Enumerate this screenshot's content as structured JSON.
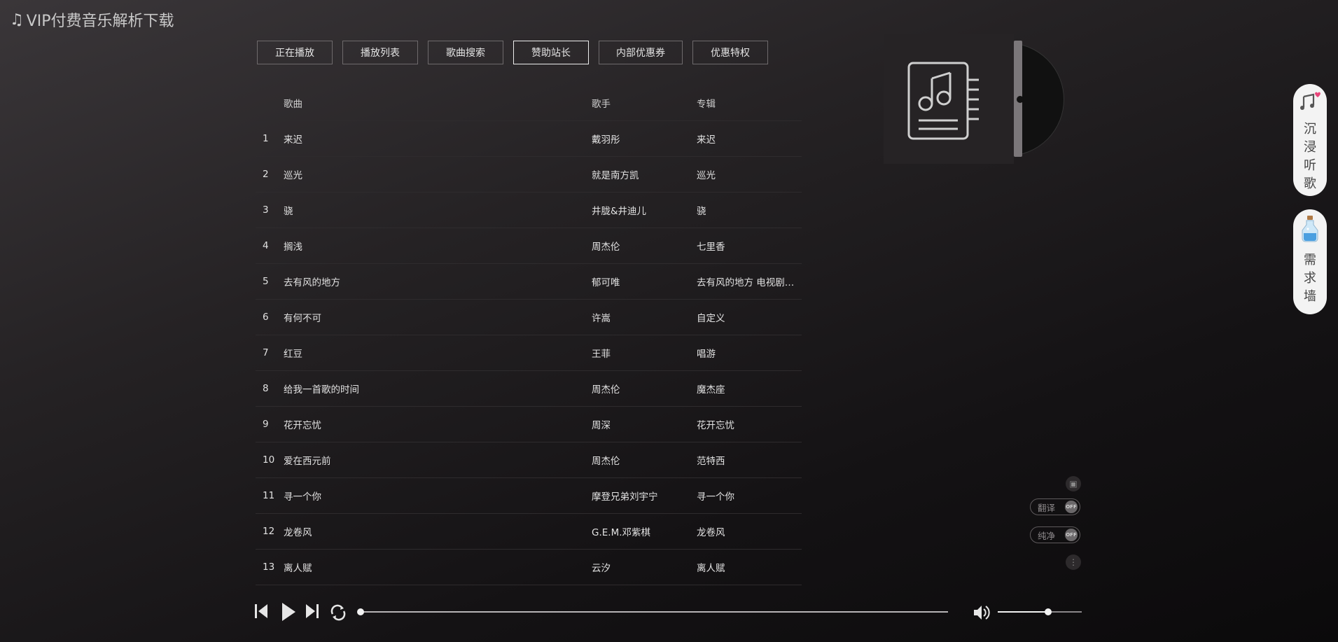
{
  "app": {
    "title": "VIP付费音乐解析下载"
  },
  "tabs": [
    {
      "label": "正在播放",
      "width": 108
    },
    {
      "label": "播放列表",
      "width": 108
    },
    {
      "label": "歌曲搜索",
      "width": 108
    },
    {
      "label": "赞助站长",
      "width": 108,
      "active": true
    },
    {
      "label": "内部优惠券",
      "width": 120
    },
    {
      "label": "优惠特权",
      "width": 108
    }
  ],
  "songlist": {
    "headers": {
      "name": "歌曲",
      "artist": "歌手",
      "album": "专辑"
    },
    "rows": [
      {
        "num": "1",
        "name": "来迟",
        "artist": "戴羽彤",
        "album": "来迟"
      },
      {
        "num": "2",
        "name": "巡光",
        "artist": "就是南方凯",
        "album": "巡光"
      },
      {
        "num": "3",
        "name": "骁",
        "artist": "井胧&井迪儿",
        "album": "骁"
      },
      {
        "num": "4",
        "name": "搁浅",
        "artist": "周杰伦",
        "album": "七里香"
      },
      {
        "num": "5",
        "name": "去有风的地方",
        "artist": "郁可唯",
        "album": "去有风的地方 电视剧…"
      },
      {
        "num": "6",
        "name": "有何不可",
        "artist": "许嵩",
        "album": "自定义"
      },
      {
        "num": "7",
        "name": "红豆",
        "artist": "王菲",
        "album": "唱游"
      },
      {
        "num": "8",
        "name": "给我一首歌的时间",
        "artist": "周杰伦",
        "album": "魔杰座"
      },
      {
        "num": "9",
        "name": "花开忘忧",
        "artist": "周深",
        "album": "花开忘忧"
      },
      {
        "num": "10",
        "name": "爱在西元前",
        "artist": "周杰伦",
        "album": "范特西"
      },
      {
        "num": "11",
        "name": "寻一个你",
        "artist": "摩登兄弟刘宇宁",
        "album": "寻一个你"
      },
      {
        "num": "12",
        "name": "龙卷风",
        "artist": "G.E.M.邓紫棋",
        "album": "龙卷风"
      },
      {
        "num": "13",
        "name": "离人赋",
        "artist": "云汐",
        "album": "离人赋"
      }
    ]
  },
  "side": {
    "immersive_chars": [
      "沉",
      "浸",
      "听",
      "歌"
    ],
    "wishwall_chars": [
      "需",
      "求",
      "墙"
    ]
  },
  "lyric_tools": {
    "translate_label": "翻译",
    "translate_state": "OFF",
    "pure_label": "纯净",
    "pure_state": "OFF"
  },
  "player": {
    "progress": 0.0,
    "volume": 0.6
  },
  "icons": {
    "logo": "music-note-icon",
    "cover": "music-document-icon",
    "prev": "skip-previous-icon",
    "play": "play-icon",
    "next": "skip-next-icon",
    "loop": "loop-icon",
    "volume": "volume-icon"
  }
}
